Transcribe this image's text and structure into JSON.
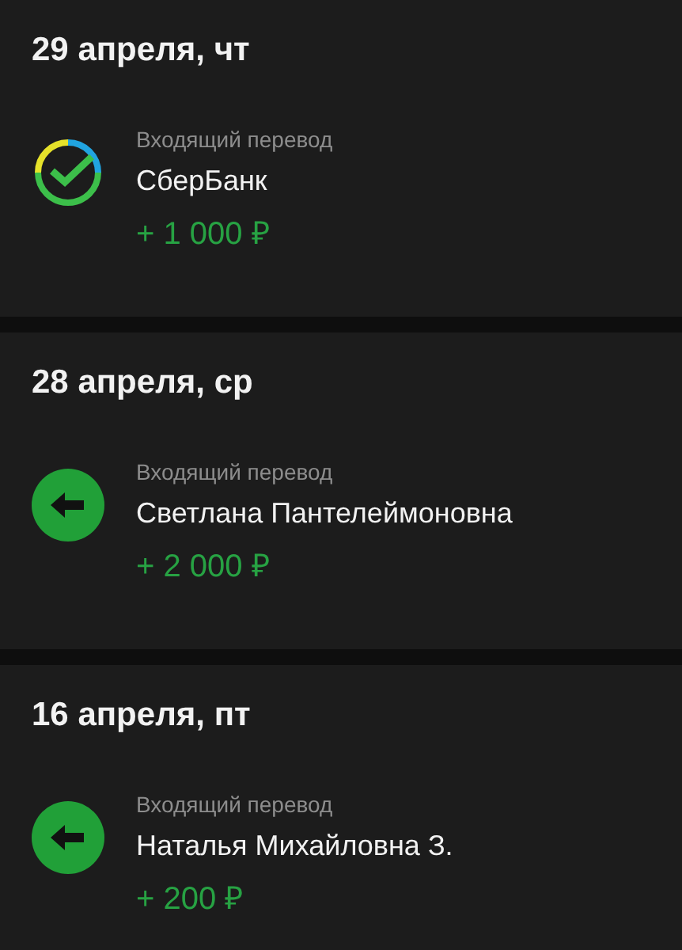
{
  "days": [
    {
      "date": "29 апреля, чт",
      "transactions": [
        {
          "kind": "bank",
          "type": "Входящий перевод",
          "name": "СберБанк",
          "amount": "+ 1 000 ₽"
        }
      ]
    },
    {
      "date": "28 апреля, ср",
      "transactions": [
        {
          "kind": "person",
          "type": "Входящий перевод",
          "name": "Светлана Пантелеймоновна",
          "amount": "+ 2 000 ₽"
        }
      ]
    },
    {
      "date": "16 апреля, пт",
      "transactions": [
        {
          "kind": "person",
          "type": "Входящий перевод",
          "name": "Наталья Михайловна З.",
          "amount": "+ 200 ₽"
        }
      ]
    }
  ]
}
